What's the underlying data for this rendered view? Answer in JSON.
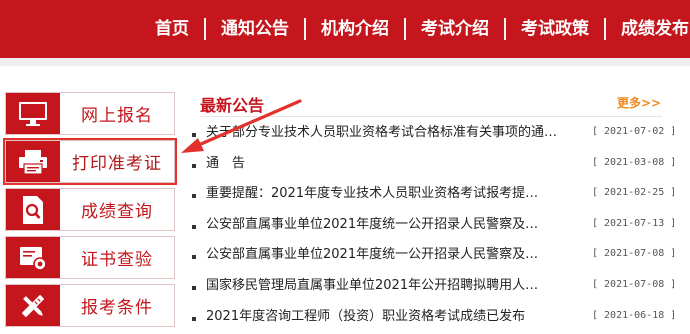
{
  "nav": {
    "items": [
      {
        "label": "首页"
      },
      {
        "label": "通知公告"
      },
      {
        "label": "机构介绍"
      },
      {
        "label": "考试介绍"
      },
      {
        "label": "考试政策"
      },
      {
        "label": "成绩发布"
      }
    ]
  },
  "quick_links": [
    {
      "label": "网上报名",
      "icon": "monitor-icon"
    },
    {
      "label": "打印准考证",
      "icon": "printer-icon"
    },
    {
      "label": "成绩查询",
      "icon": "search-document-icon"
    },
    {
      "label": "证书查验",
      "icon": "certificate-icon"
    },
    {
      "label": "报考条件",
      "icon": "tools-icon"
    }
  ],
  "news": {
    "title": "最新公告",
    "more": "更多>>",
    "items": [
      {
        "text": "关于部分专业技术人员职业资格考试合格标准有关事项的通…",
        "date": "[ 2021-07-02 ]"
      },
      {
        "text": "通　告",
        "date": "[ 2021-03-08 ]"
      },
      {
        "text": "重要提醒：2021年度专业技术人员职业资格考试报考提…",
        "date": "[ 2021-02-25 ]"
      },
      {
        "text": "公安部直属事业单位2021年度统一公开招录人民警察及…",
        "date": "[ 2021-07-13 ]"
      },
      {
        "text": "公安部直属事业单位2021年度统一公开招录人民警察及…",
        "date": "[ 2021-07-08 ]"
      },
      {
        "text": "国家移民管理局直属事业单位2021年公开招聘拟聘用人…",
        "date": "[ 2021-07-08 ]"
      },
      {
        "text": "2021年度咨询工程师（投资）职业资格考试成绩已发布",
        "date": "[ 2021-06-18 ]"
      }
    ]
  },
  "colors": {
    "brand_red": "#c4161c",
    "more_orange": "#f08a22",
    "annotation_red": "#e3322e"
  }
}
